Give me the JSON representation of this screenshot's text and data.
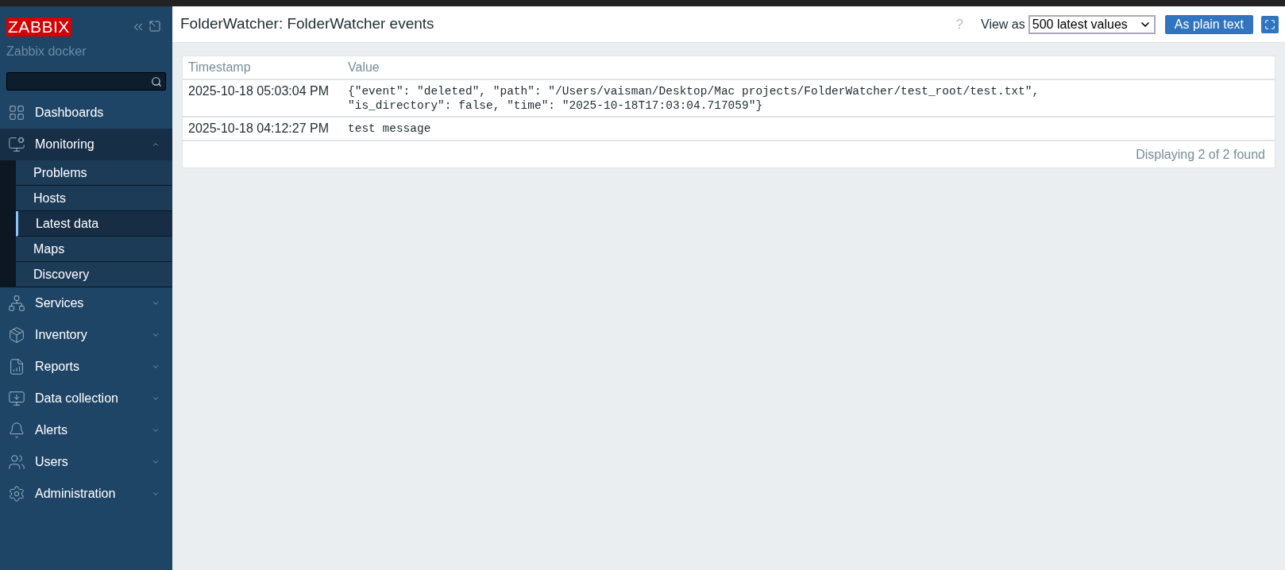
{
  "sidebar": {
    "logo": "ZABBIX",
    "server_name": "Zabbix docker",
    "menu": [
      {
        "label": "Dashboards",
        "has_submenu": false,
        "expanded": false
      },
      {
        "label": "Monitoring",
        "has_submenu": true,
        "expanded": true,
        "children": [
          {
            "label": "Problems",
            "selected": false
          },
          {
            "label": "Hosts",
            "selected": false
          },
          {
            "label": "Latest data",
            "selected": true
          },
          {
            "label": "Maps",
            "selected": false
          },
          {
            "label": "Discovery",
            "selected": false
          }
        ]
      },
      {
        "label": "Services",
        "has_submenu": true,
        "expanded": false
      },
      {
        "label": "Inventory",
        "has_submenu": true,
        "expanded": false
      },
      {
        "label": "Reports",
        "has_submenu": true,
        "expanded": false
      },
      {
        "label": "Data collection",
        "has_submenu": true,
        "expanded": false
      },
      {
        "label": "Alerts",
        "has_submenu": true,
        "expanded": false
      },
      {
        "label": "Users",
        "has_submenu": true,
        "expanded": false
      },
      {
        "label": "Administration",
        "has_submenu": true,
        "expanded": false
      }
    ]
  },
  "header": {
    "title": "FolderWatcher: FolderWatcher events",
    "help": "?",
    "view_as_label": "View as",
    "view_as_value": "500 latest values",
    "plain_text_button": "As plain text"
  },
  "table": {
    "columns": [
      "Timestamp",
      "Value"
    ],
    "rows": [
      {
        "timestamp": "2025-10-18 05:03:04 PM",
        "value": "{\"event\": \"deleted\", \"path\": \"/Users/vaisman/Desktop/Mac projects/FolderWatcher/test_root/test.txt\",\n\"is_directory\": false, \"time\": \"2025-10-18T17:03:04.717059\"}"
      },
      {
        "timestamp": "2025-10-18 04:12:27 PM",
        "value": "test message"
      }
    ],
    "footer": "Displaying 2 of 2 found"
  }
}
